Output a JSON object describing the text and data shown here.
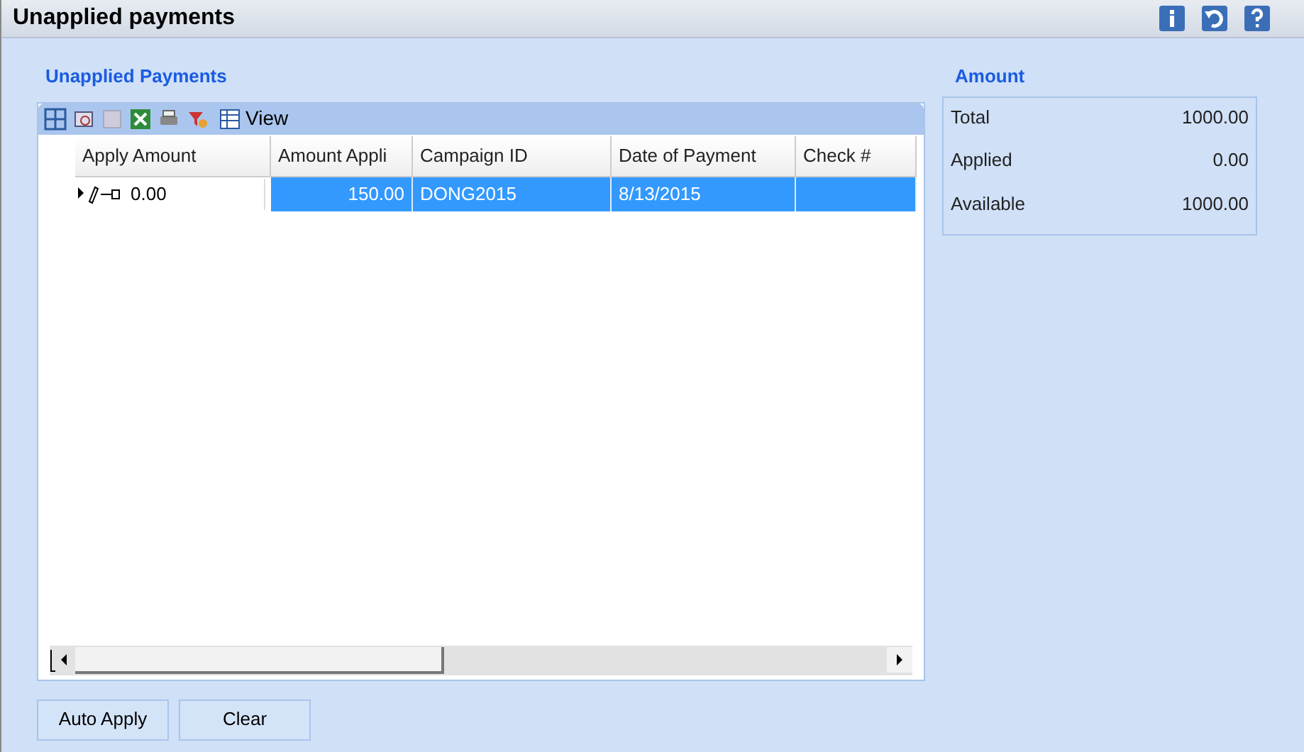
{
  "window": {
    "title": "Unapplied payments"
  },
  "payments": {
    "title": "Unapplied Payments",
    "toolbar": {
      "view_label": "View"
    },
    "columns": [
      "Apply Amount",
      "Amount Appli",
      "Campaign ID",
      "Date of Payment",
      "Check #"
    ],
    "rows": [
      {
        "apply_amount": "0.00",
        "amount_applied": "150.00",
        "campaign_id": "DONG2015",
        "date_of_payment": "8/13/2015",
        "check": "",
        "selected": true
      }
    ]
  },
  "amount": {
    "title": "Amount",
    "items": [
      {
        "label": "Total",
        "value": "1000.00"
      },
      {
        "label": "Applied",
        "value": "0.00"
      },
      {
        "label": "Available",
        "value": "1000.00"
      }
    ]
  },
  "buttons": [
    "Auto Apply",
    "Clear"
  ]
}
